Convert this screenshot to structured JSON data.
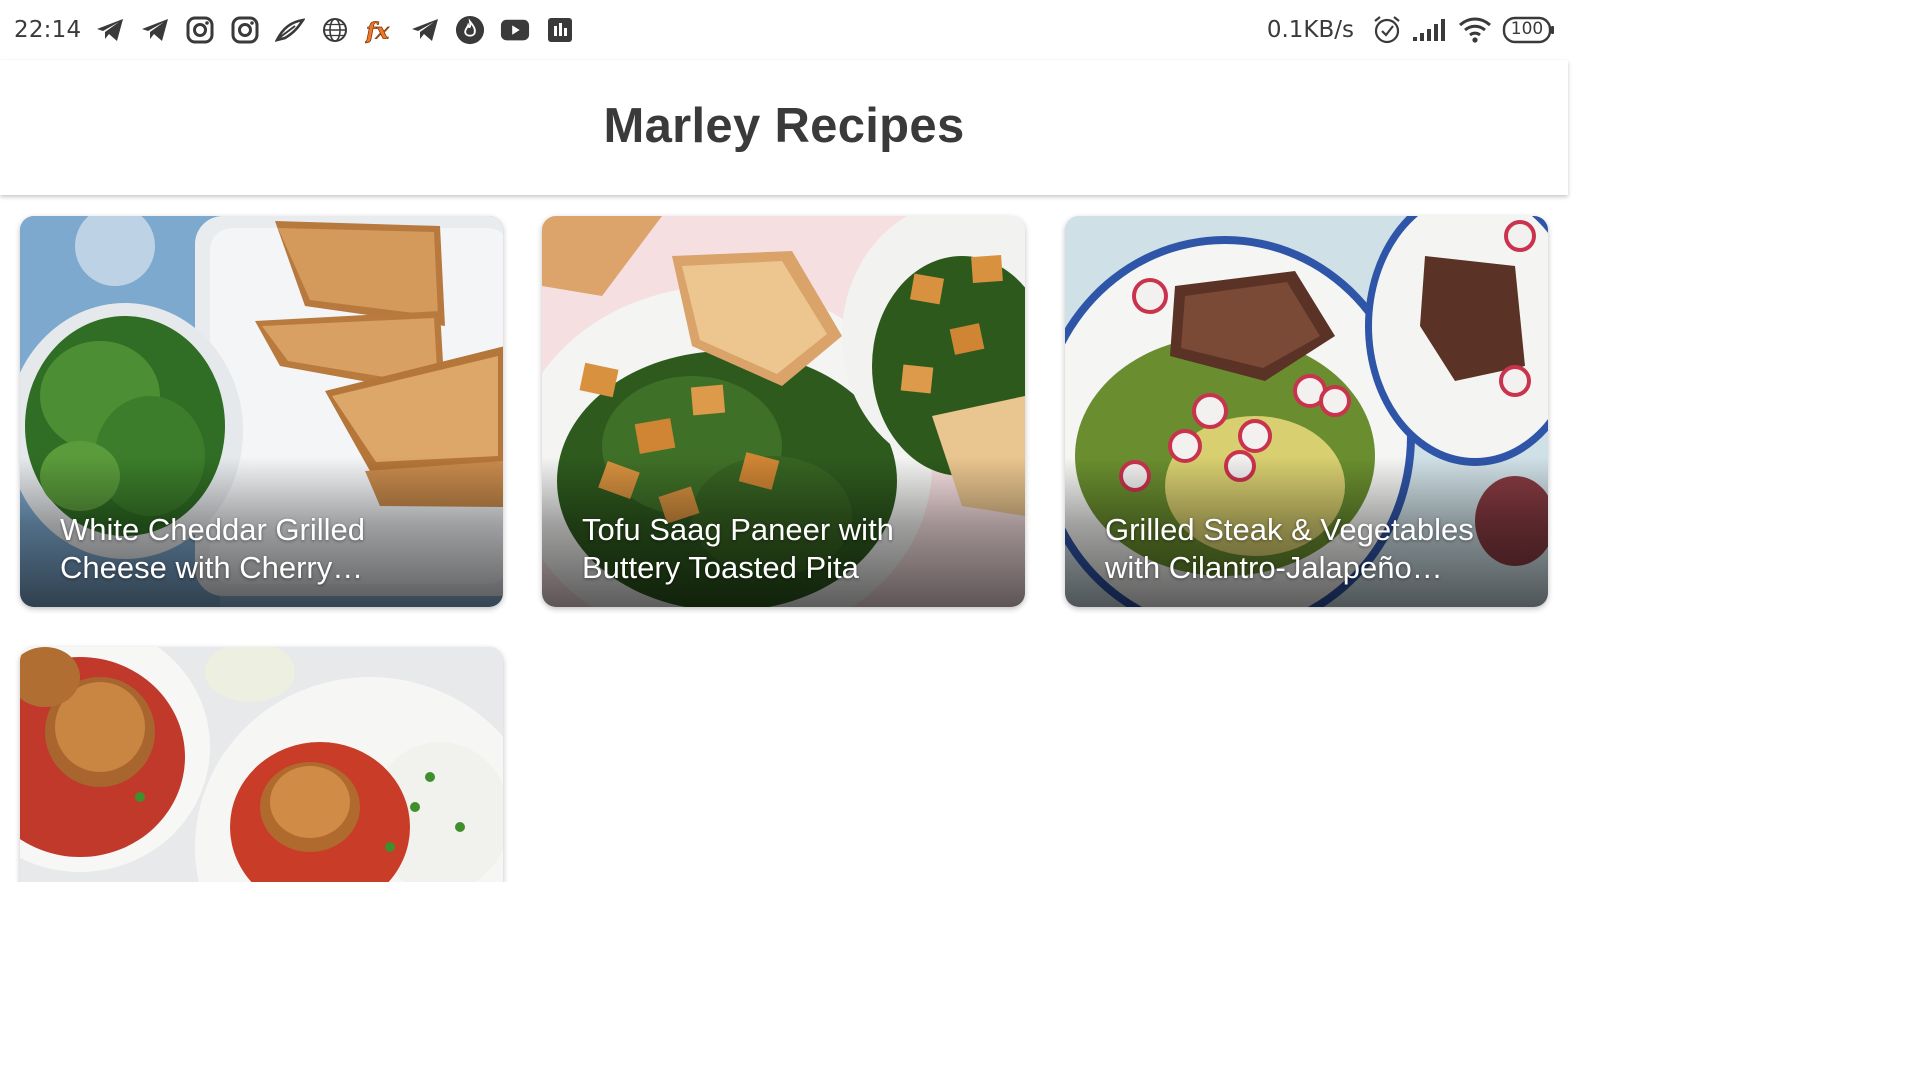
{
  "status_bar": {
    "time": "22:14",
    "left_icons": [
      "telegram-icon",
      "telegram-icon",
      "instagram-icon",
      "instagram-icon",
      "feather-app-icon",
      "globe-icon",
      "fx-app-icon",
      "telegram-icon",
      "fire-app-icon",
      "youtube-icon",
      "stats-app-icon"
    ],
    "net_speed": "0.1KB/s",
    "right_icons": [
      "alarm-icon",
      "signal-icon",
      "wifi-icon",
      "battery-icon"
    ],
    "battery_level": "100"
  },
  "app_bar": {
    "title": "Marley Recipes"
  },
  "recipes": [
    {
      "title": "White Cheddar Grilled Cheese with Cherry Preserves"
    },
    {
      "title": "Tofu Saag Paneer with Buttery Toasted Pita"
    },
    {
      "title": "Grilled Steak & Vegetables with Cilantro-Jalapeño Dressing"
    },
    {
      "title": ""
    }
  ],
  "colors": {
    "text_dark": "#3a3a3a",
    "card_text": "#ffffff",
    "accent_orange": "#f0782a"
  }
}
